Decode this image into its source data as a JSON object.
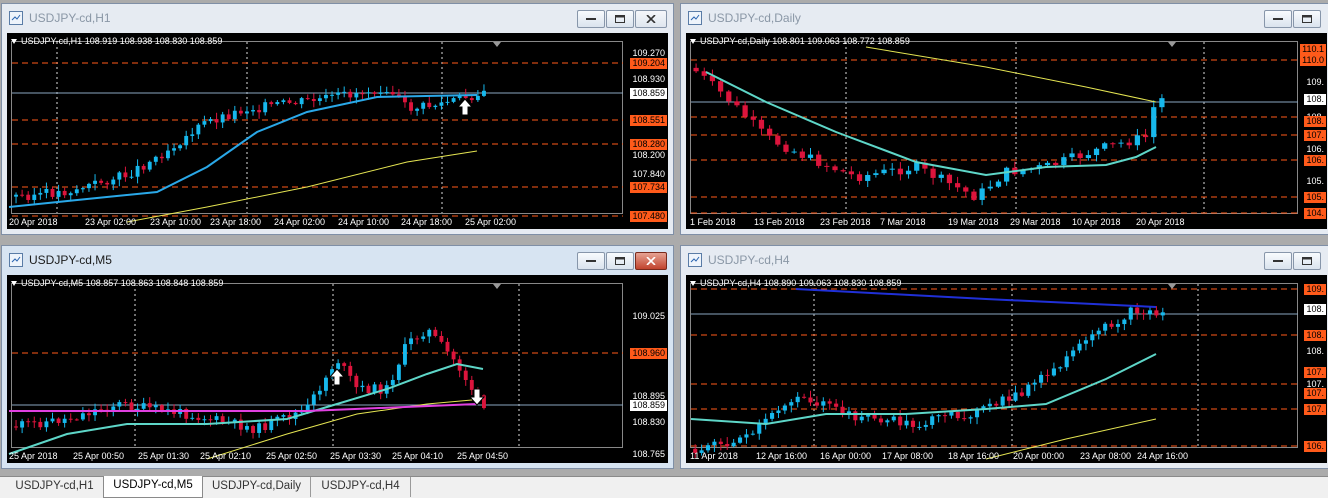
{
  "windows": [
    {
      "id": "h1",
      "title": "USDJPY-cd,H1",
      "active": false,
      "info": "USDJPY-cd,H1  108.919 108.938 108.830 108.859",
      "price_labels": [
        {
          "text": "109.270",
          "style": "dk"
        },
        {
          "text": "109.204",
          "style": "hl"
        },
        {
          "text": "108.930",
          "style": "dk"
        },
        {
          "text": "108.859",
          "style": "cur"
        },
        {
          "text": "108.551",
          "style": "hl"
        },
        {
          "text": "108.280",
          "style": "hl"
        },
        {
          "text": "108.200",
          "style": "dk"
        },
        {
          "text": "107.840",
          "style": "dk"
        },
        {
          "text": "107.734",
          "style": "hl"
        },
        {
          "text": "107.480",
          "style": "hl"
        }
      ],
      "x_labels": [
        "20 Apr 2018",
        "23 Apr 02:00",
        "23 Apr 10:00",
        "23 Apr 18:00",
        "24 Apr 02:00",
        "24 Apr 10:00",
        "24 Apr 18:00",
        "25 Apr 02:00"
      ]
    },
    {
      "id": "daily",
      "title": "USDJPY-cd,Daily",
      "active": false,
      "info": "USDJPY-cd,Daily  108.801 109.063 108.772 108.859",
      "price_labels": [
        {
          "text": "110.1",
          "style": "hl"
        },
        {
          "text": "110.0",
          "style": "hl"
        },
        {
          "text": "109.",
          "style": "dk"
        },
        {
          "text": "108.",
          "style": "cur"
        },
        {
          "text": "108.",
          "style": "dk"
        },
        {
          "text": "108.",
          "style": "hl"
        },
        {
          "text": "107.",
          "style": "hl"
        },
        {
          "text": "106.",
          "style": "dk"
        },
        {
          "text": "106.",
          "style": "hl"
        },
        {
          "text": "105.",
          "style": "dk"
        },
        {
          "text": "105.",
          "style": "hl"
        },
        {
          "text": "104.",
          "style": "hl"
        }
      ],
      "x_labels": [
        "1 Feb 2018",
        "13 Feb 2018",
        "23 Feb 2018",
        "7 Mar 2018",
        "19 Mar 2018",
        "29 Mar 2018",
        "10 Apr 2018",
        "20 Apr 2018"
      ]
    },
    {
      "id": "m5",
      "title": "USDJPY-cd,M5",
      "active": true,
      "info": "USDJPY-cd,M5  108.857 108.863 108.848 108.859",
      "price_labels": [
        {
          "text": "109.025",
          "style": "dk"
        },
        {
          "text": "108.960",
          "style": "hl"
        },
        {
          "text": "108.895",
          "style": "dk"
        },
        {
          "text": "108.859",
          "style": "cur"
        },
        {
          "text": "108.830",
          "style": "dk"
        },
        {
          "text": "108.765",
          "style": "dk"
        }
      ],
      "x_labels": [
        "25 Apr 2018",
        "25 Apr 00:50",
        "25 Apr 01:30",
        "25 Apr 02:10",
        "25 Apr 02:50",
        "25 Apr 03:30",
        "25 Apr 04:10",
        "25 Apr 04:50"
      ]
    },
    {
      "id": "h4",
      "title": "USDJPY-cd,H4",
      "active": false,
      "info": "USDJPY-cd,H4  108.890 109.063 108.830 108.859",
      "price_labels": [
        {
          "text": "109.",
          "style": "hl"
        },
        {
          "text": "108.",
          "style": "cur"
        },
        {
          "text": "108.",
          "style": "hl"
        },
        {
          "text": "108.",
          "style": "dk"
        },
        {
          "text": "107.",
          "style": "hl"
        },
        {
          "text": "107.",
          "style": "dk"
        },
        {
          "text": "107.",
          "style": "hl"
        },
        {
          "text": "107.",
          "style": "hl"
        },
        {
          "text": "106.",
          "style": "hl"
        }
      ],
      "x_labels": [
        "11 Apr 2018",
        "12 Apr 16:00",
        "16 Apr 00:00",
        "17 Apr 08:00",
        "18 Apr 16:00",
        "20 Apr 00:00",
        "23 Apr 08:00",
        "24 Apr 16:00"
      ]
    }
  ],
  "tabs": [
    {
      "label": "USDJPY-cd,H1",
      "active": false
    },
    {
      "label": "USDJPY-cd,M5",
      "active": true
    },
    {
      "label": "USDJPY-cd,Daily",
      "active": false
    },
    {
      "label": "USDJPY-cd,H4",
      "active": false
    }
  ],
  "colors": {
    "bull": "#17b8ec",
    "bear": "#dc143c",
    "ma_fast": "#5ed6c8",
    "ma_slow": "#e5e552",
    "ma_h1": "#2aa8e8",
    "level": "#ff5a1a",
    "magenta": "#e040e0",
    "blue": "#2030d8"
  }
}
